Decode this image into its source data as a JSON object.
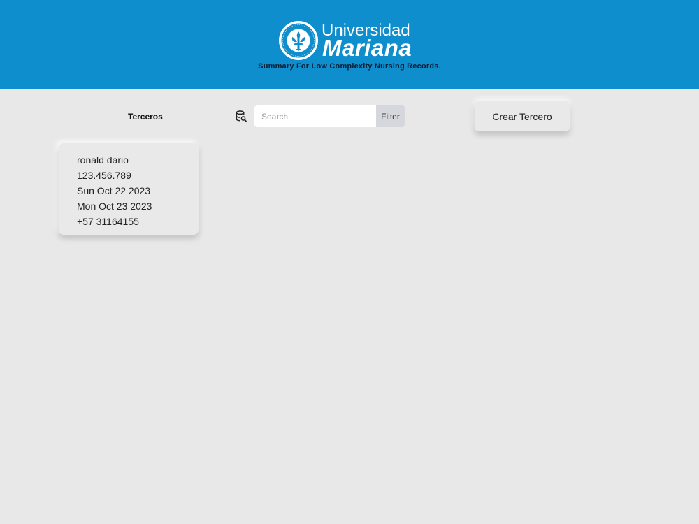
{
  "header": {
    "logo_line_1": "Universidad",
    "logo_line_2": "Mariana",
    "subtitle": "Summary For Low Complexity Nursing Records.",
    "brand_color": "#0f8ecd"
  },
  "toolbar": {
    "section_title": "Terceros",
    "search_icon": "database-search-icon",
    "search_placeholder": "Search",
    "search_value": "",
    "filter_label": "Filter",
    "create_label": "Crear Tercero"
  },
  "records": [
    {
      "name": "ronald dario",
      "id_number": "123.456.789",
      "date_1": "Sun Oct 22 2023",
      "date_2": "Mon Oct 23 2023",
      "phone": "+57 31164155"
    }
  ]
}
